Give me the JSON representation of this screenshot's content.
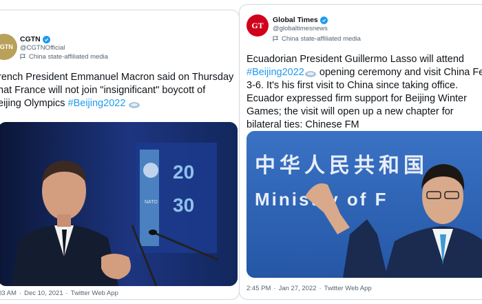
{
  "left_tweet": {
    "avatar_initials": "CGTN",
    "name": "CGTN",
    "handle": "@CGTNOfficial",
    "affiliation": "China state-affiliated media",
    "text_lines": [
      "rench President Emmanuel Macron said on Thursday",
      "hat France will not join \"insignificant\" boycott of",
      "eijing Olympics "
    ],
    "hashtag": "#Beijing2022",
    "time": "03 AM",
    "date": "Dec 10, 2021",
    "source": "Twitter Web App",
    "media_badge_numbers": [
      "20",
      "30"
    ],
    "media_caption": "NATO"
  },
  "right_tweet": {
    "avatar_initials": "GT",
    "name": "Global Times",
    "handle": "@globaltimesnews",
    "affiliation": "China state-affiliated media",
    "text_line1_pre": "Ecuadorian President Guillermo Lasso will attend",
    "hashtag": "#Beijing2022",
    "text_line2_post": " opening ceremony and visit China Fe",
    "text_lines_rest": [
      "3-6. It's his first visit to China since taking office.",
      "Ecuador expressed firm support for Beijing Winter",
      "Games; the visit will open up a new chapter for",
      "bilateral ties: Chinese FM"
    ],
    "time": "2:45 PM",
    "date": "Jan 27, 2022",
    "source": "Twitter Web App",
    "media_sign_cn": "中华人民共和国",
    "media_sign_en": "Ministry of F"
  },
  "colors": {
    "link_blue": "#1d9bf0",
    "gt_red": "#d0021b",
    "cgtn_gold": "#b9a15a"
  },
  "separator": "·"
}
